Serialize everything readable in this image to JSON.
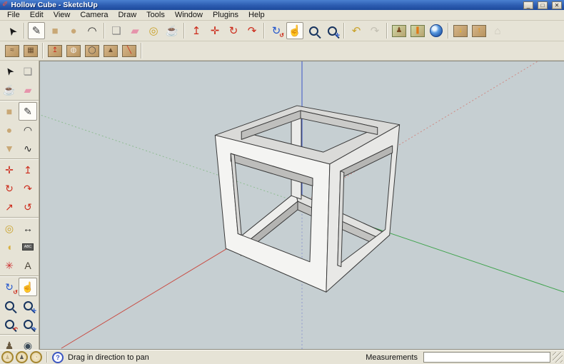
{
  "window": {
    "title": "Hollow Cube - SketchUp",
    "logo_icon": "✐",
    "controls": {
      "minimize": "_",
      "maximize": "□",
      "close": "✕"
    }
  },
  "menu": {
    "items": [
      {
        "name": "menu-file",
        "label": "File"
      },
      {
        "name": "menu-edit",
        "label": "Edit"
      },
      {
        "name": "menu-view",
        "label": "View"
      },
      {
        "name": "menu-camera",
        "label": "Camera"
      },
      {
        "name": "menu-draw",
        "label": "Draw"
      },
      {
        "name": "menu-tools",
        "label": "Tools"
      },
      {
        "name": "menu-window",
        "label": "Window"
      },
      {
        "name": "menu-plugins",
        "label": "Plugins"
      },
      {
        "name": "menu-help",
        "label": "Help"
      }
    ]
  },
  "toolbar_main": {
    "items": [
      {
        "name": "select-tool-icon",
        "label": "Select",
        "glyph": "➤",
        "color": "#1a1a1a",
        "cls": "rot135"
      },
      {
        "type": "sep"
      },
      {
        "name": "line-tool-icon",
        "label": "Line",
        "glyph": "✎",
        "color": "#3a3a3a",
        "state": "hot"
      },
      {
        "name": "rectangle-tool-icon",
        "label": "Rectangle",
        "glyph": "■",
        "color": "#c9a876"
      },
      {
        "name": "circle-tool-icon",
        "label": "Circle",
        "glyph": "●",
        "color": "#c9a876"
      },
      {
        "name": "arc-tool-icon",
        "label": "Arc",
        "glyph": "◠",
        "color": "#2a2a2a"
      },
      {
        "type": "sep"
      },
      {
        "name": "make-component-tool-icon",
        "label": "Make Component",
        "glyph": "❏",
        "color": "#8a8a88"
      },
      {
        "name": "eraser-tool-icon",
        "label": "Eraser",
        "glyph": "▰",
        "color": "#e693ab"
      },
      {
        "name": "tape-measure-tool-icon",
        "label": "Tape Measure",
        "glyph": "◎",
        "color": "#c9a22a"
      },
      {
        "name": "paint-bucket-tool-icon",
        "label": "Paint Bucket",
        "glyph": "☕",
        "color": "#c9a22a"
      },
      {
        "type": "sep"
      },
      {
        "name": "push-pull-tool-icon",
        "label": "Push/Pull",
        "glyph": "↥",
        "color": "#cc2a1a"
      },
      {
        "name": "move-tool-icon",
        "label": "Move",
        "glyph": "✛",
        "color": "#cc2a1a"
      },
      {
        "name": "rotate-tool-icon",
        "label": "Rotate",
        "glyph": "↻",
        "color": "#cc2a1a"
      },
      {
        "name": "offset-tool-icon",
        "label": "Offset",
        "glyph": "↷",
        "color": "#cc2a1a"
      },
      {
        "type": "sep"
      },
      {
        "name": "orbit-tool-icon",
        "label": "Orbit",
        "glyph": "↻",
        "color": "#2255cc",
        "overlay": "↺",
        "ocolor": "#cc2a1a"
      },
      {
        "name": "pan-tool-icon",
        "label": "Pan",
        "glyph": "☝",
        "color": "#b8845a",
        "state": "active"
      },
      {
        "name": "zoom-tool-icon",
        "label": "Zoom",
        "cls": "mag"
      },
      {
        "name": "zoom-extents-tool-icon",
        "label": "Zoom Extents",
        "cls": "mag",
        "overlay": "✛",
        "ocolor": "#2255cc"
      },
      {
        "type": "sep"
      },
      {
        "name": "previous-view-icon",
        "label": "Previous",
        "glyph": "↶",
        "color": "#c9a22a"
      },
      {
        "name": "next-view-icon",
        "label": "Next",
        "glyph": "↷",
        "color": "#a8a498",
        "state": "disabled"
      },
      {
        "type": "sep"
      },
      {
        "name": "add-location-icon",
        "label": "Add Location",
        "cls": "tile-photo",
        "glyph": "♟",
        "color": "#7a4a22"
      },
      {
        "name": "toggle-terrain-icon",
        "label": "Toggle Terrain",
        "cls": "tile-photo",
        "glyph": "❚",
        "color": "#e07818"
      },
      {
        "name": "google-earth-icon",
        "label": "Preview Model in Google Earth",
        "cls": "globe"
      },
      {
        "type": "sep"
      },
      {
        "name": "get-models-icon",
        "label": "Get Models",
        "cls": "tile",
        "glyph": "↓",
        "color": "#f5c000"
      },
      {
        "name": "share-model-icon",
        "label": "Share Model",
        "cls": "tile",
        "glyph": "↑",
        "color": "#f09000"
      },
      {
        "name": "component-house-icon",
        "label": "Component",
        "glyph": "⌂",
        "color": "#b4b0a4",
        "state": "disabled"
      }
    ]
  },
  "toolbar_sandbox": {
    "items": [
      {
        "name": "from-contours-tool-icon",
        "label": "From Contours",
        "cls": "tile",
        "glyph": "≈",
        "color": "#6a4e2e"
      },
      {
        "name": "from-scratch-tool-icon",
        "label": "From Scratch",
        "cls": "tile",
        "glyph": "▦",
        "color": "#6a4e2e"
      },
      {
        "type": "sep"
      },
      {
        "name": "smoove-tool-icon",
        "label": "Smoove",
        "cls": "tile",
        "glyph": "↥",
        "color": "#cc2a1a"
      },
      {
        "name": "stamp-tool-icon",
        "label": "Stamp",
        "cls": "tile",
        "glyph": "◍",
        "color": "#f0f0ee"
      },
      {
        "name": "drape-tool-icon",
        "label": "Drape",
        "cls": "tile",
        "glyph": "◯",
        "color": "#444444"
      },
      {
        "name": "add-detail-tool-icon",
        "label": "Add Detail",
        "cls": "tile",
        "glyph": "▲",
        "color": "#6a4e2e"
      },
      {
        "name": "flip-edge-tool-icon",
        "label": "Flip Edge",
        "cls": "tile",
        "glyph": "╲",
        "color": "#cc2a1a"
      },
      {
        "type": "sep"
      }
    ]
  },
  "left_toolbar": {
    "items": [
      {
        "name": "lt-select-tool-icon",
        "label": "Select",
        "glyph": "➤",
        "color": "#1a1a1a",
        "cls": "rot135"
      },
      {
        "name": "lt-make-component-tool-icon",
        "label": "Make Component",
        "glyph": "❏",
        "color": "#8a8a88"
      },
      {
        "name": "lt-paint-bucket-tool-icon",
        "label": "Paint Bucket",
        "glyph": "☕",
        "color": "#c9a22a"
      },
      {
        "name": "lt-eraser-tool-icon",
        "label": "Eraser",
        "glyph": "▰",
        "color": "#e693ab"
      },
      {
        "type": "sep"
      },
      {
        "name": "lt-rectangle-tool-icon",
        "label": "Rectangle",
        "glyph": "■",
        "color": "#c9a876"
      },
      {
        "name": "lt-line-tool-icon",
        "label": "Line",
        "glyph": "✎",
        "color": "#3a3a3a",
        "state": "hot"
      },
      {
        "name": "lt-circle-tool-icon",
        "label": "Circle",
        "glyph": "●",
        "color": "#c9a876"
      },
      {
        "name": "lt-arc-tool-icon",
        "label": "Arc",
        "glyph": "◠",
        "color": "#2a2a2a"
      },
      {
        "name": "lt-polygon-tool-icon",
        "label": "Polygon",
        "glyph": "▼",
        "color": "#c9a876"
      },
      {
        "name": "lt-freehand-tool-icon",
        "label": "Freehand",
        "glyph": "∿",
        "color": "#2a2a2a"
      },
      {
        "type": "sep"
      },
      {
        "name": "lt-move-tool-icon",
        "label": "Move",
        "glyph": "✛",
        "color": "#cc2a1a"
      },
      {
        "name": "lt-push-pull-tool-icon",
        "label": "Push/Pull",
        "glyph": "↥",
        "color": "#cc2a1a"
      },
      {
        "name": "lt-rotate-tool-icon",
        "label": "Rotate",
        "glyph": "↻",
        "color": "#cc2a1a"
      },
      {
        "name": "lt-follow-me-tool-icon",
        "label": "Follow Me",
        "glyph": "↷",
        "color": "#cc2a1a"
      },
      {
        "name": "lt-scale-tool-icon",
        "label": "Scale",
        "glyph": "↗",
        "color": "#cc2a1a"
      },
      {
        "name": "lt-offset-tool-icon",
        "label": "Offset",
        "glyph": "↺",
        "color": "#cc2a1a"
      },
      {
        "type": "sep"
      },
      {
        "name": "lt-tape-measure-tool-icon",
        "label": "Tape Measure",
        "glyph": "◎",
        "color": "#c9a22a"
      },
      {
        "name": "lt-dimension-tool-icon",
        "label": "Dimension",
        "glyph": "↔",
        "color": "#2a2a2a"
      },
      {
        "name": "lt-protractor-tool-icon",
        "label": "Protractor",
        "glyph": "◖",
        "color": "#d8b040"
      },
      {
        "name": "lt-text-tool-icon",
        "label": "Text",
        "cls": "abc",
        "glyph": "ABC"
      },
      {
        "name": "lt-axes-tool-icon",
        "label": "Axes",
        "glyph": "✳",
        "color": "#cc3333"
      },
      {
        "name": "lt-3d-text-tool-icon",
        "label": "3D Text",
        "glyph": "A",
        "color": "#4a4438"
      },
      {
        "type": "sep"
      },
      {
        "name": "lt-orbit-tool-icon",
        "label": "Orbit",
        "glyph": "↻",
        "color": "#2255cc",
        "overlay": "↺",
        "ocolor": "#cc2a1a"
      },
      {
        "name": "lt-pan-tool-icon",
        "label": "Pan",
        "glyph": "☝",
        "color": "#b8845a",
        "state": "active"
      },
      {
        "name": "lt-zoom-tool-icon",
        "label": "Zoom",
        "cls": "mag"
      },
      {
        "name": "lt-zoom-extents-tool-icon",
        "label": "Zoom Extents",
        "cls": "mag",
        "overlay": "✛",
        "ocolor": "#2255cc"
      },
      {
        "name": "lt-previous-view-icon",
        "label": "Previous",
        "cls": "mag",
        "overlay": "↶",
        "ocolor": "#cc2a1a"
      },
      {
        "name": "lt-next-view-icon",
        "label": "Next",
        "cls": "mag",
        "overlay": "↷",
        "ocolor": "#2255cc"
      },
      {
        "type": "sep"
      },
      {
        "name": "lt-position-camera-tool-icon",
        "label": "Position Camera",
        "glyph": "♟",
        "color": "#6a5a40"
      },
      {
        "name": "lt-look-around-tool-icon",
        "label": "Look Around",
        "glyph": "◉",
        "color": "#3a4a58"
      }
    ]
  },
  "canvas": {
    "colors": {
      "bg": "#c6cfd2",
      "axis_red": "#c94b42",
      "axis_green": "#3fa34d",
      "axis_blue": "#3c55c8",
      "axis_red_dotted": "#cf8a84",
      "axis_green_dotted": "#8fbd92",
      "axis_blue_dotted": "#8d97cf",
      "face_front": "#f4f4f2",
      "face_right": "#e8e8e6",
      "face_top": "#dadad8",
      "edge": "#3a3a3a"
    },
    "model_name": "hollow-cube"
  },
  "statusbar": {
    "status_icons": [
      {
        "name": "status-person-icon",
        "glyph": "♟",
        "color": "#c9b68a"
      },
      {
        "name": "status-pin-icon",
        "glyph": "♟",
        "color": "#555555"
      },
      {
        "name": "status-globe-icon",
        "glyph": "◔",
        "color": "#c9b68a"
      }
    ],
    "help_icon": "?",
    "hint": "Drag in direction to pan",
    "measurements_label": "Measurements",
    "measurements_value": ""
  }
}
